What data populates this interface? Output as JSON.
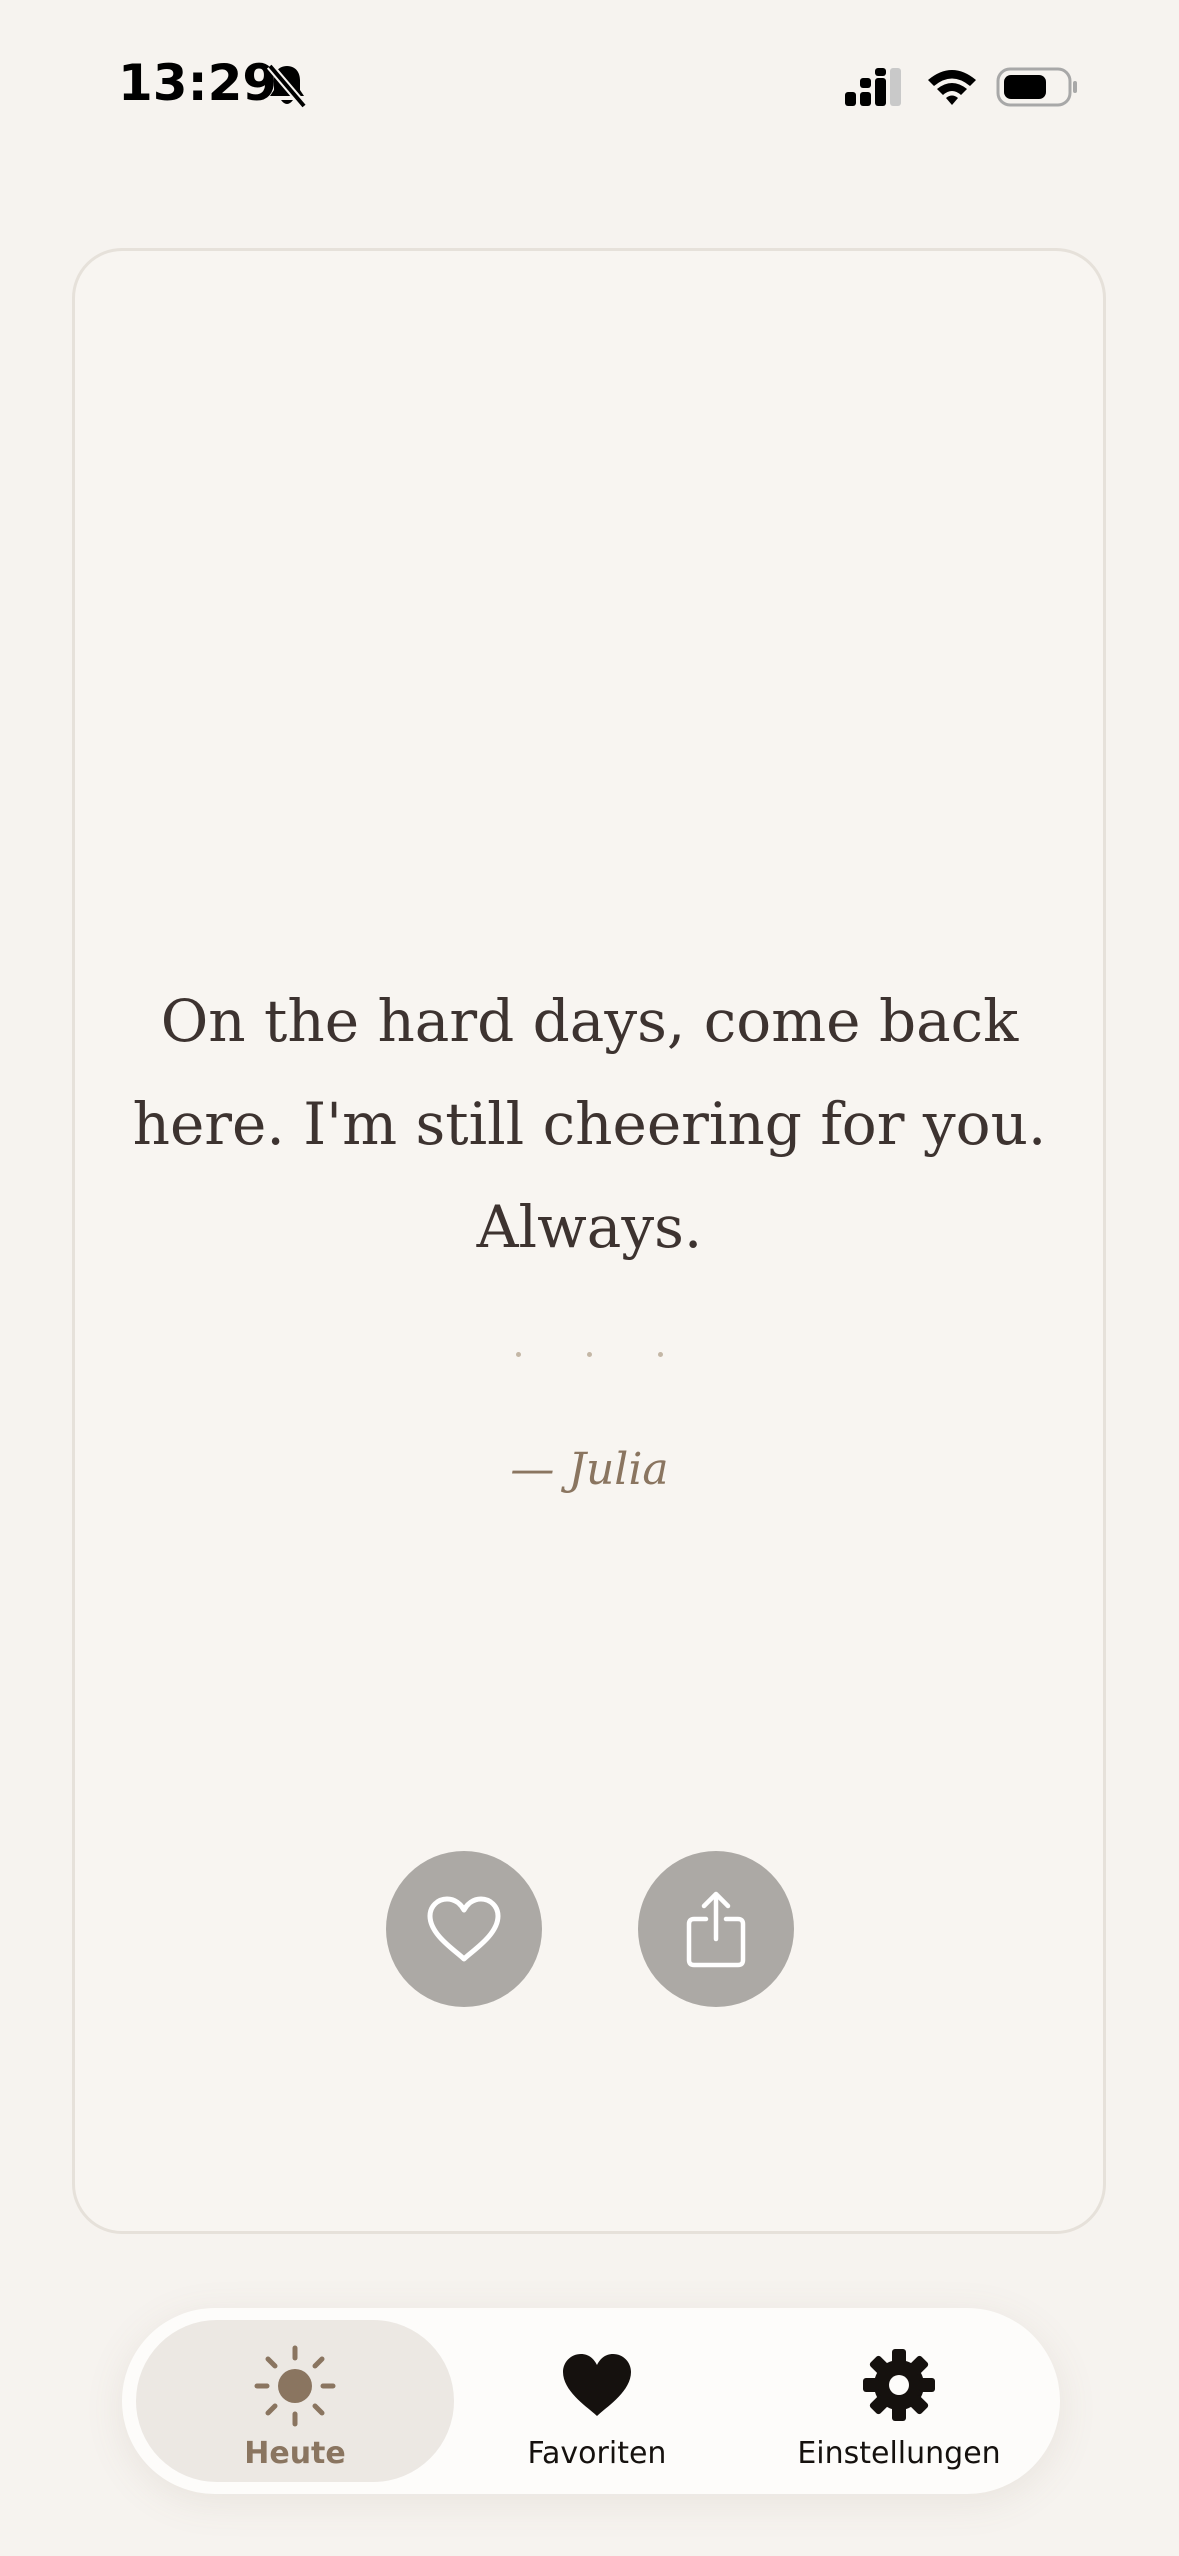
{
  "status_bar": {
    "time": "13:29"
  },
  "quote": {
    "text": "On the hard days, come back here. I'm still cheering for you. Always.",
    "author": "— Julia"
  },
  "actions": {
    "favorite_icon": "heart-outline-icon",
    "share_icon": "share-icon"
  },
  "tabs": [
    {
      "label": "Heute",
      "icon": "sun-icon",
      "active": true
    },
    {
      "label": "Favoriten",
      "icon": "heart-icon",
      "active": false
    },
    {
      "label": "Einstellungen",
      "icon": "gear-icon",
      "active": false
    }
  ],
  "colors": {
    "background": "#f6f3ef",
    "card_border": "#e6e1da",
    "quote_text": "#3d3330",
    "accent": "#8a7560",
    "button_fill": "#aca9a5",
    "tab_active_bg": "#ece8e3"
  }
}
